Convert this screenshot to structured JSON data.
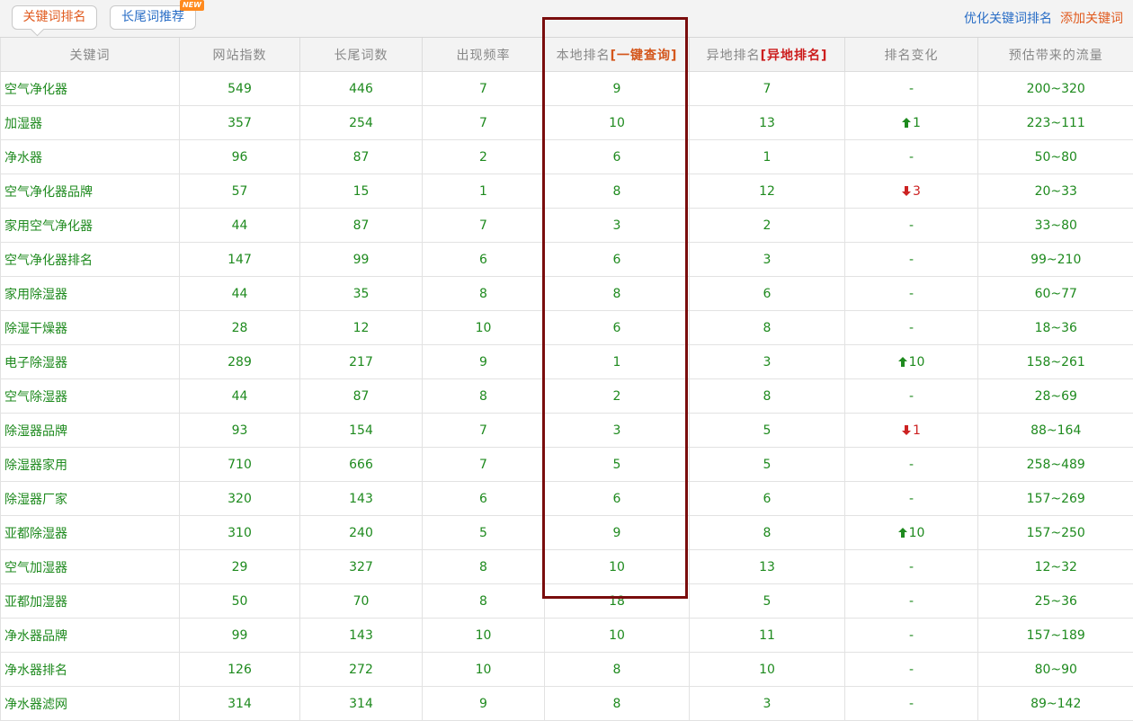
{
  "tabs": {
    "active_label": "关键词排名",
    "longtail_label": "长尾词推荐",
    "new_badge": "NEW"
  },
  "links": {
    "optimize": "优化关键词排名",
    "add": "添加关键词"
  },
  "headers": {
    "keyword": "关键词",
    "site_index": "网站指数",
    "longtail_count": "长尾词数",
    "frequency": "出现频率",
    "local_rank": "本地排名",
    "local_query": "[一键查询]",
    "remote_rank": "异地排名",
    "remote_query": "[异地排名]",
    "rank_change": "排名变化",
    "traffic": "预估带来的流量"
  },
  "rows": [
    {
      "keyword": "空气净化器",
      "site_index": "549",
      "longtail": "446",
      "freq": "7",
      "local": "9",
      "remote": "7",
      "change": {
        "dir": "none",
        "value": "-"
      },
      "traffic": "200~320"
    },
    {
      "keyword": "加湿器",
      "site_index": "357",
      "longtail": "254",
      "freq": "7",
      "local": "10",
      "remote": "13",
      "change": {
        "dir": "up",
        "value": "1"
      },
      "traffic": "223~111"
    },
    {
      "keyword": "净水器",
      "site_index": "96",
      "longtail": "87",
      "freq": "2",
      "local": "6",
      "remote": "1",
      "change": {
        "dir": "none",
        "value": "-"
      },
      "traffic": "50~80"
    },
    {
      "keyword": "空气净化器品牌",
      "site_index": "57",
      "longtail": "15",
      "freq": "1",
      "local": "8",
      "remote": "12",
      "change": {
        "dir": "down",
        "value": "3"
      },
      "traffic": "20~33"
    },
    {
      "keyword": "家用空气净化器",
      "site_index": "44",
      "longtail": "87",
      "freq": "7",
      "local": "3",
      "remote": "2",
      "change": {
        "dir": "none",
        "value": "-"
      },
      "traffic": "33~80"
    },
    {
      "keyword": "空气净化器排名",
      "site_index": "147",
      "longtail": "99",
      "freq": "6",
      "local": "6",
      "remote": "3",
      "change": {
        "dir": "none",
        "value": "-"
      },
      "traffic": "99~210"
    },
    {
      "keyword": "家用除湿器",
      "site_index": "44",
      "longtail": "35",
      "freq": "8",
      "local": "8",
      "remote": "6",
      "change": {
        "dir": "none",
        "value": "-"
      },
      "traffic": "60~77"
    },
    {
      "keyword": "除湿干燥器",
      "site_index": "28",
      "longtail": "12",
      "freq": "10",
      "local": "6",
      "remote": "8",
      "change": {
        "dir": "none",
        "value": "-"
      },
      "traffic": "18~36"
    },
    {
      "keyword": "电子除湿器",
      "site_index": "289",
      "longtail": "217",
      "freq": "9",
      "local": "1",
      "remote": "3",
      "change": {
        "dir": "up",
        "value": "10"
      },
      "traffic": "158~261"
    },
    {
      "keyword": "空气除湿器",
      "site_index": "44",
      "longtail": "87",
      "freq": "8",
      "local": "2",
      "remote": "8",
      "change": {
        "dir": "none",
        "value": "-"
      },
      "traffic": "28~69"
    },
    {
      "keyword": "除湿器品牌",
      "site_index": "93",
      "longtail": "154",
      "freq": "7",
      "local": "3",
      "remote": "5",
      "change": {
        "dir": "down",
        "value": "1"
      },
      "traffic": "88~164"
    },
    {
      "keyword": "除湿器家用",
      "site_index": "710",
      "longtail": "666",
      "freq": "7",
      "local": "5",
      "remote": "5",
      "change": {
        "dir": "none",
        "value": "-"
      },
      "traffic": "258~489"
    },
    {
      "keyword": "除湿器厂家",
      "site_index": "320",
      "longtail": "143",
      "freq": "6",
      "local": "6",
      "remote": "6",
      "change": {
        "dir": "none",
        "value": "-"
      },
      "traffic": "157~269"
    },
    {
      "keyword": "亚都除湿器",
      "site_index": "310",
      "longtail": "240",
      "freq": "5",
      "local": "9",
      "remote": "8",
      "change": {
        "dir": "up",
        "value": "10"
      },
      "traffic": "157~250"
    },
    {
      "keyword": "空气加湿器",
      "site_index": "29",
      "longtail": "327",
      "freq": "8",
      "local": "10",
      "remote": "13",
      "change": {
        "dir": "none",
        "value": "-"
      },
      "traffic": "12~32"
    },
    {
      "keyword": "亚都加湿器",
      "site_index": "50",
      "longtail": "70",
      "freq": "8",
      "local": "18",
      "remote": "5",
      "change": {
        "dir": "none",
        "value": "-"
      },
      "traffic": "25~36"
    },
    {
      "keyword": "净水器品牌",
      "site_index": "99",
      "longtail": "143",
      "freq": "10",
      "local": "10",
      "remote": "11",
      "change": {
        "dir": "none",
        "value": "-"
      },
      "traffic": "157~189"
    },
    {
      "keyword": "净水器排名",
      "site_index": "126",
      "longtail": "272",
      "freq": "10",
      "local": "8",
      "remote": "10",
      "change": {
        "dir": "none",
        "value": "-"
      },
      "traffic": "80~90"
    },
    {
      "keyword": "净水器滤网",
      "site_index": "314",
      "longtail": "314",
      "freq": "9",
      "local": "8",
      "remote": "3",
      "change": {
        "dir": "none",
        "value": "-"
      },
      "traffic": "89~142"
    }
  ],
  "colors": {
    "accent_orange": "#e05a1e",
    "link_blue": "#2a6ec6",
    "value_green": "#1e8a1e",
    "down_red": "#cc2222",
    "highlight_box": "#7a0d0d"
  }
}
